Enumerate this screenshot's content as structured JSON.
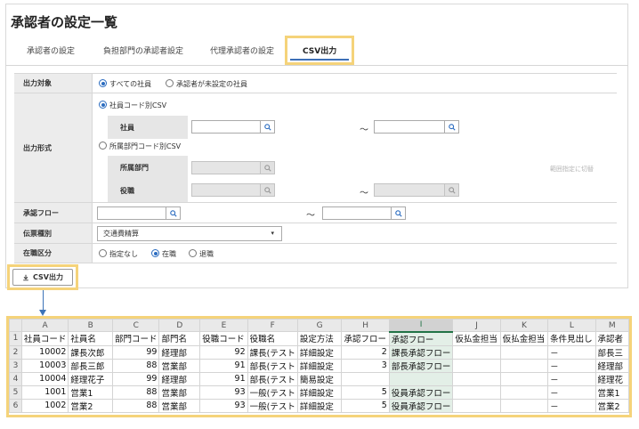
{
  "page": {
    "title": "承認者の設定一覧"
  },
  "tabs": [
    {
      "label": "承認者の設定"
    },
    {
      "label": "負担部門の承認者設定"
    },
    {
      "label": "代理承認者の設定"
    },
    {
      "label": "CSV出力"
    }
  ],
  "form": {
    "output_target": {
      "label": "出力対象",
      "options": [
        "すべての社員",
        "承認者が未設定の社員"
      ],
      "selected": "すべての社員"
    },
    "output_format": {
      "label": "出力形式",
      "option1": "社員コード別CSV",
      "employee_label": "社員",
      "option2": "所属部門コード別CSV",
      "department_label": "所属部門",
      "position_label": "役職",
      "range_toggle": "範囲指定に切替",
      "selected": "社員コード別CSV"
    },
    "approval_flow": {
      "label": "承認フロー"
    },
    "slip_type": {
      "label": "伝票種別",
      "value": "交通費精算"
    },
    "employment": {
      "label": "在職区分",
      "options": [
        "指定なし",
        "在職",
        "退職"
      ],
      "selected": "在職"
    },
    "tilde": "～"
  },
  "csv_button": {
    "label": "CSV出力"
  },
  "spreadsheet": {
    "columns": [
      "A",
      "B",
      "C",
      "D",
      "E",
      "F",
      "G",
      "H",
      "I",
      "J",
      "K",
      "L",
      "M"
    ],
    "selected_column": "I",
    "rows": [
      {
        "n": "1",
        "cells": [
          "社員コード",
          "社員名",
          "部門コード",
          "部門名",
          "役職コード",
          "役職名",
          "設定方法",
          "承認フロー",
          "承認フロー",
          "仮払金担当",
          "仮払金担当",
          "条件見出し",
          "承認者"
        ]
      },
      {
        "n": "2",
        "cells": [
          "10002",
          "課長次郎",
          "99",
          "経理部",
          "92",
          "課長(テスト",
          "詳細設定",
          "2",
          "課長承認フロー",
          "",
          "",
          "－",
          "部長三"
        ]
      },
      {
        "n": "3",
        "cells": [
          "10003",
          "部長三郎",
          "88",
          "営業部",
          "91",
          "部長(テスト",
          "詳細設定",
          "3",
          "部長承認フロー",
          "",
          "",
          "－",
          "経理部"
        ]
      },
      {
        "n": "4",
        "cells": [
          "10004",
          "経理花子",
          "99",
          "経理部",
          "91",
          "部長(テスト",
          "簡易設定",
          "",
          "",
          "",
          "",
          "－",
          "経理花"
        ]
      },
      {
        "n": "5",
        "cells": [
          "1001",
          "営業1",
          "88",
          "営業部",
          "93",
          "一般(テスト",
          "詳細設定",
          "5",
          "役員承認フロー",
          "",
          "",
          "－",
          "営業1"
        ]
      },
      {
        "n": "6",
        "cells": [
          "1002",
          "営業2",
          "88",
          "営業部",
          "93",
          "一般(テスト",
          "詳細設定",
          "5",
          "役員承認フロー",
          "",
          "",
          "－",
          "営業2"
        ]
      }
    ]
  },
  "colors": {
    "accent": "#2b6cc0",
    "highlight": "#f5d37a",
    "excel_green": "#217346"
  }
}
